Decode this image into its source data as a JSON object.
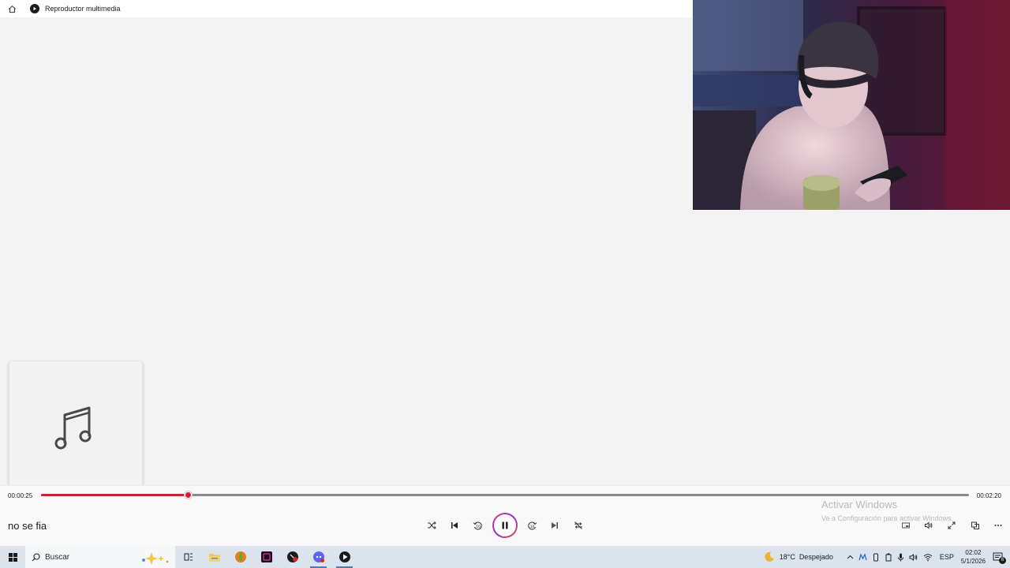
{
  "titlebar": {
    "title": "Reproductor multimedia",
    "home_icon": "home-icon",
    "app_icon": "media-player-icon"
  },
  "album_art": {
    "icon": "music-note-icon"
  },
  "player": {
    "current_time": "00:00:25",
    "total_time": "00:02:20",
    "progress_fraction": 0.158,
    "song_title": "no se fia",
    "accent_color": "#c4262e",
    "controls": [
      "shuffle-icon",
      "previous-icon",
      "rewind-10-icon",
      "pause-icon",
      "forward-30-icon",
      "next-icon",
      "repeat-icon"
    ],
    "right_controls": [
      "miniplayer-icon",
      "volume-icon",
      "fullscreen-icon",
      "cast-icon",
      "more-icon"
    ]
  },
  "watermark": {
    "title": "Activar Windows",
    "subtitle": "Ve a Configuración para activar Windows."
  },
  "taskbar": {
    "search_placeholder": "Buscar",
    "apps": [
      "windows-start-icon",
      "task-view-icon",
      "file-explorer-icon",
      "fl-studio-icon",
      "editor-app-icon",
      "app-icon",
      "discord-icon",
      "media-player-icon"
    ],
    "weather": {
      "temp": "18°C",
      "condition": "Despejado"
    },
    "language": "ESP",
    "time": "02:02",
    "date": "5/1/2026",
    "notification_count": "6"
  }
}
